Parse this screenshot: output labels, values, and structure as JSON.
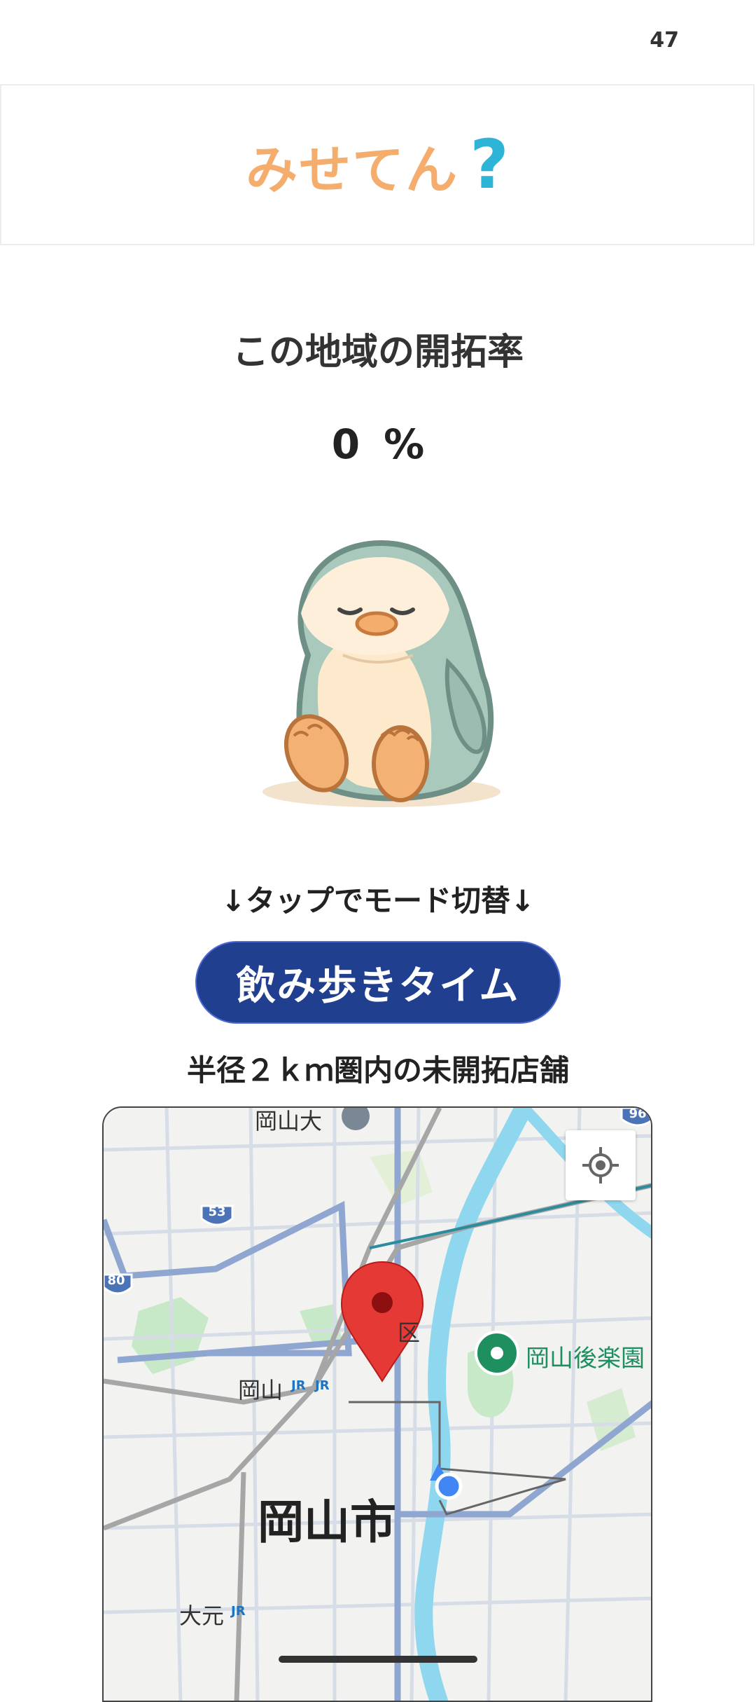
{
  "status_bar": {
    "number": "47"
  },
  "header": {
    "logo_text": "みせてん",
    "logo_mark": "?"
  },
  "main": {
    "title": "この地域の開拓率",
    "rate_value": "0",
    "rate_unit": "%",
    "mode_hint": "↓タップでモード切替↓",
    "mode_button_label": "飲み歩きタイム",
    "radius_label": "半径２ｋｍ圏内の未開拓店舗"
  },
  "map": {
    "labels": {
      "university": "岡山大",
      "city": "岡山市",
      "station_okayama": "岡山",
      "station_omoto": "大元",
      "garden": "岡山後楽園",
      "ward": "区",
      "jr": "JR"
    },
    "route_shields": [
      "53",
      "80",
      "96"
    ],
    "colors": {
      "water": "#8fd7ee",
      "main_road": "#8fa6d0",
      "park": "#c8e9c8",
      "pin": "#e53935",
      "user_dot": "#4285f4"
    }
  },
  "colors": {
    "logo": "#f4ad6c",
    "logo_mark": "#2db4d6",
    "button_bg": "#213f8f"
  }
}
